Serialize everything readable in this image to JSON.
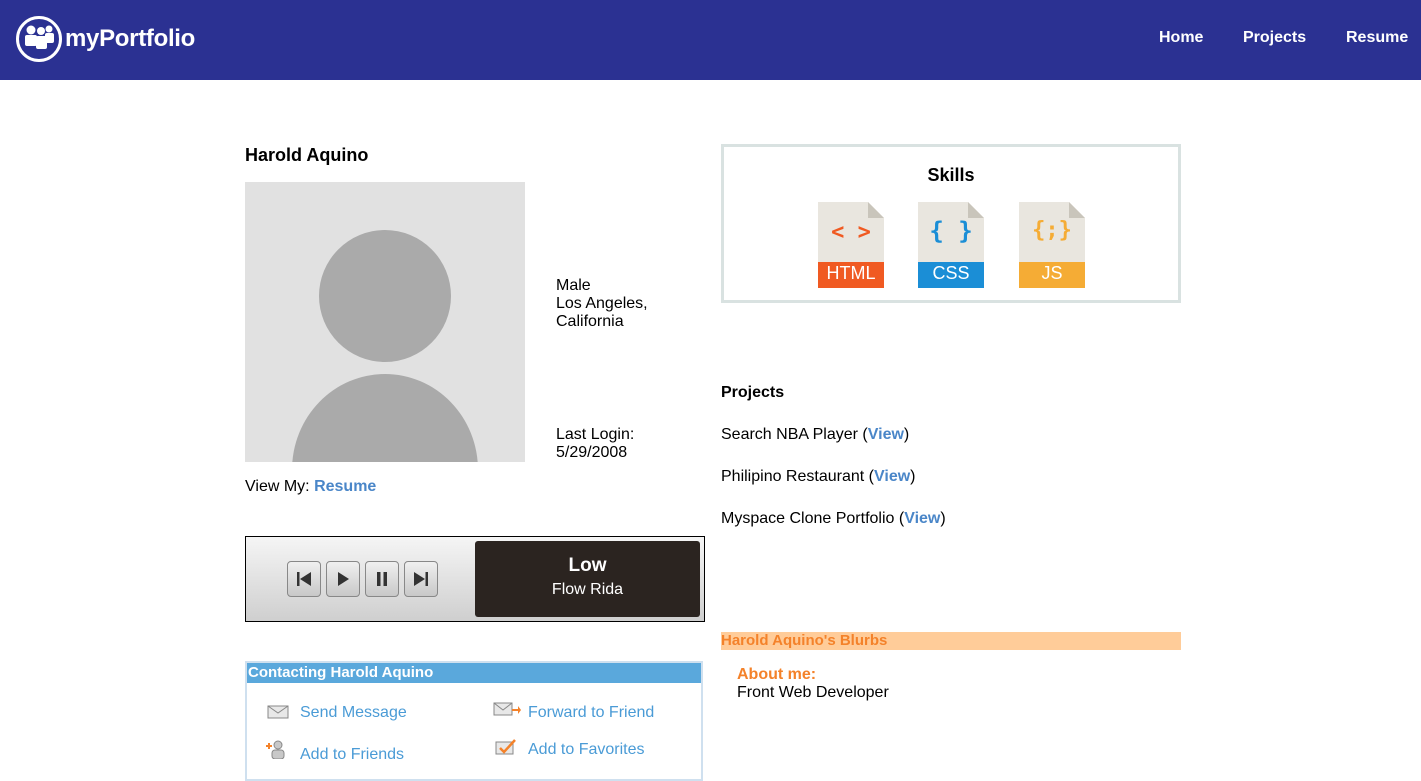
{
  "nav": {
    "brand": "myPortfolio",
    "links": [
      "Home",
      "Projects",
      "Resume"
    ]
  },
  "profile": {
    "name": "Harold Aquino",
    "gender": "Male",
    "city": "Los Angeles,",
    "state": "California",
    "last_login_label": "Last Login:",
    "last_login_date": "5/29/2008",
    "view_my_label": "View My:",
    "resume_link": "Resume"
  },
  "player": {
    "song_title": "Low",
    "artist": "Flow Rida",
    "controls": [
      "previous-icon",
      "play-icon",
      "pause-icon",
      "next-icon"
    ]
  },
  "contact": {
    "title": "Contacting Harold Aquino",
    "actions": [
      "Send Message",
      "Forward to Friend",
      "Add to Friends",
      "Add to Favorites"
    ]
  },
  "skills": {
    "title": "Skills",
    "items": [
      {
        "label": "HTML",
        "symbol": "< >",
        "color": "#f05a22"
      },
      {
        "label": "CSS",
        "symbol": "{ }",
        "color": "#1b8ed6"
      },
      {
        "label": "JS",
        "symbol": "{;}",
        "color": "#f5ac35"
      }
    ]
  },
  "projects": {
    "title": "Projects",
    "items": [
      {
        "name": "Search NBA Player",
        "link": "View"
      },
      {
        "name": "Philipino Restaurant",
        "link": "View"
      },
      {
        "name": "Myspace Clone Portfolio",
        "link": "View"
      }
    ]
  },
  "blurbs": {
    "title": "Harold Aquino's Blurbs",
    "about_label": "About me:",
    "about_text": "Front Web Developer"
  },
  "colors": {
    "navbar": "#2b3192",
    "link_blue": "#4a86c8",
    "accent_orange": "#f4822a",
    "blurbs_bar": "#ffcc99",
    "contact_header": "#5aa8dc"
  }
}
